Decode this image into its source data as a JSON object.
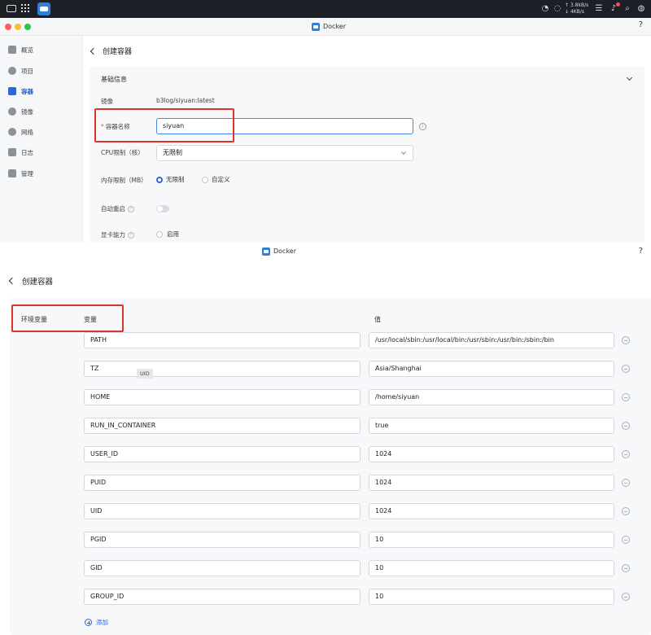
{
  "system": {
    "net_up": "↑ 3.8kB/s",
    "net_down": "↓ 4KB/s"
  },
  "window1": {
    "title": "Docker",
    "help": "?"
  },
  "sidebar": {
    "items": [
      {
        "label": "概览",
        "icon": "overview-icon",
        "active": false
      },
      {
        "label": "项目",
        "icon": "project-icon",
        "active": false
      },
      {
        "label": "容器",
        "icon": "container-icon",
        "active": true
      },
      {
        "label": "镜像",
        "icon": "image-icon",
        "active": false
      },
      {
        "label": "网络",
        "icon": "network-icon",
        "active": false
      },
      {
        "label": "日志",
        "icon": "log-icon",
        "active": false
      },
      {
        "label": "管理",
        "icon": "manage-icon",
        "active": false
      }
    ]
  },
  "page1": {
    "title": "创建容器",
    "section": "基础信息",
    "image_label": "镜像",
    "image_value": "b3log/siyuan:latest",
    "name_required": "*",
    "name_label": "容器名称",
    "name_value": "siyuan",
    "cpu_label": "CPU限制（核）",
    "cpu_value": "无限制",
    "mem_label": "内存限制（MB）",
    "mem_opt1": "无限制",
    "mem_opt2": "自定义",
    "restart_label": "自动重启",
    "gpu_label": "显卡能力",
    "gpu_opt": "启用",
    "info": "i",
    "q": "?"
  },
  "window2": {
    "title": "Docker",
    "help": "?"
  },
  "page2": {
    "title": "创建容器",
    "env_label": "环境变量",
    "col_var": "变量",
    "col_val": "值",
    "tooltip": "UID",
    "add_label": "添加",
    "env": [
      {
        "key": "PATH",
        "value": "/usr/local/sbin:/usr/local/bin:/usr/sbin:/usr/bin:/sbin:/bin"
      },
      {
        "key": "TZ",
        "value": "Asia/Shanghai"
      },
      {
        "key": "HOME",
        "value": "/home/siyuan"
      },
      {
        "key": "RUN_IN_CONTAINER",
        "value": "true"
      },
      {
        "key": "USER_ID",
        "value": "1024"
      },
      {
        "key": "PUID",
        "value": "1024"
      },
      {
        "key": "UID",
        "value": "1024"
      },
      {
        "key": "PGID",
        "value": "10"
      },
      {
        "key": "GID",
        "value": "10"
      },
      {
        "key": "GROUP_ID",
        "value": "10"
      }
    ]
  },
  "colors": {
    "accent": "#2f66d6",
    "highlight_box": "#e0312b"
  }
}
